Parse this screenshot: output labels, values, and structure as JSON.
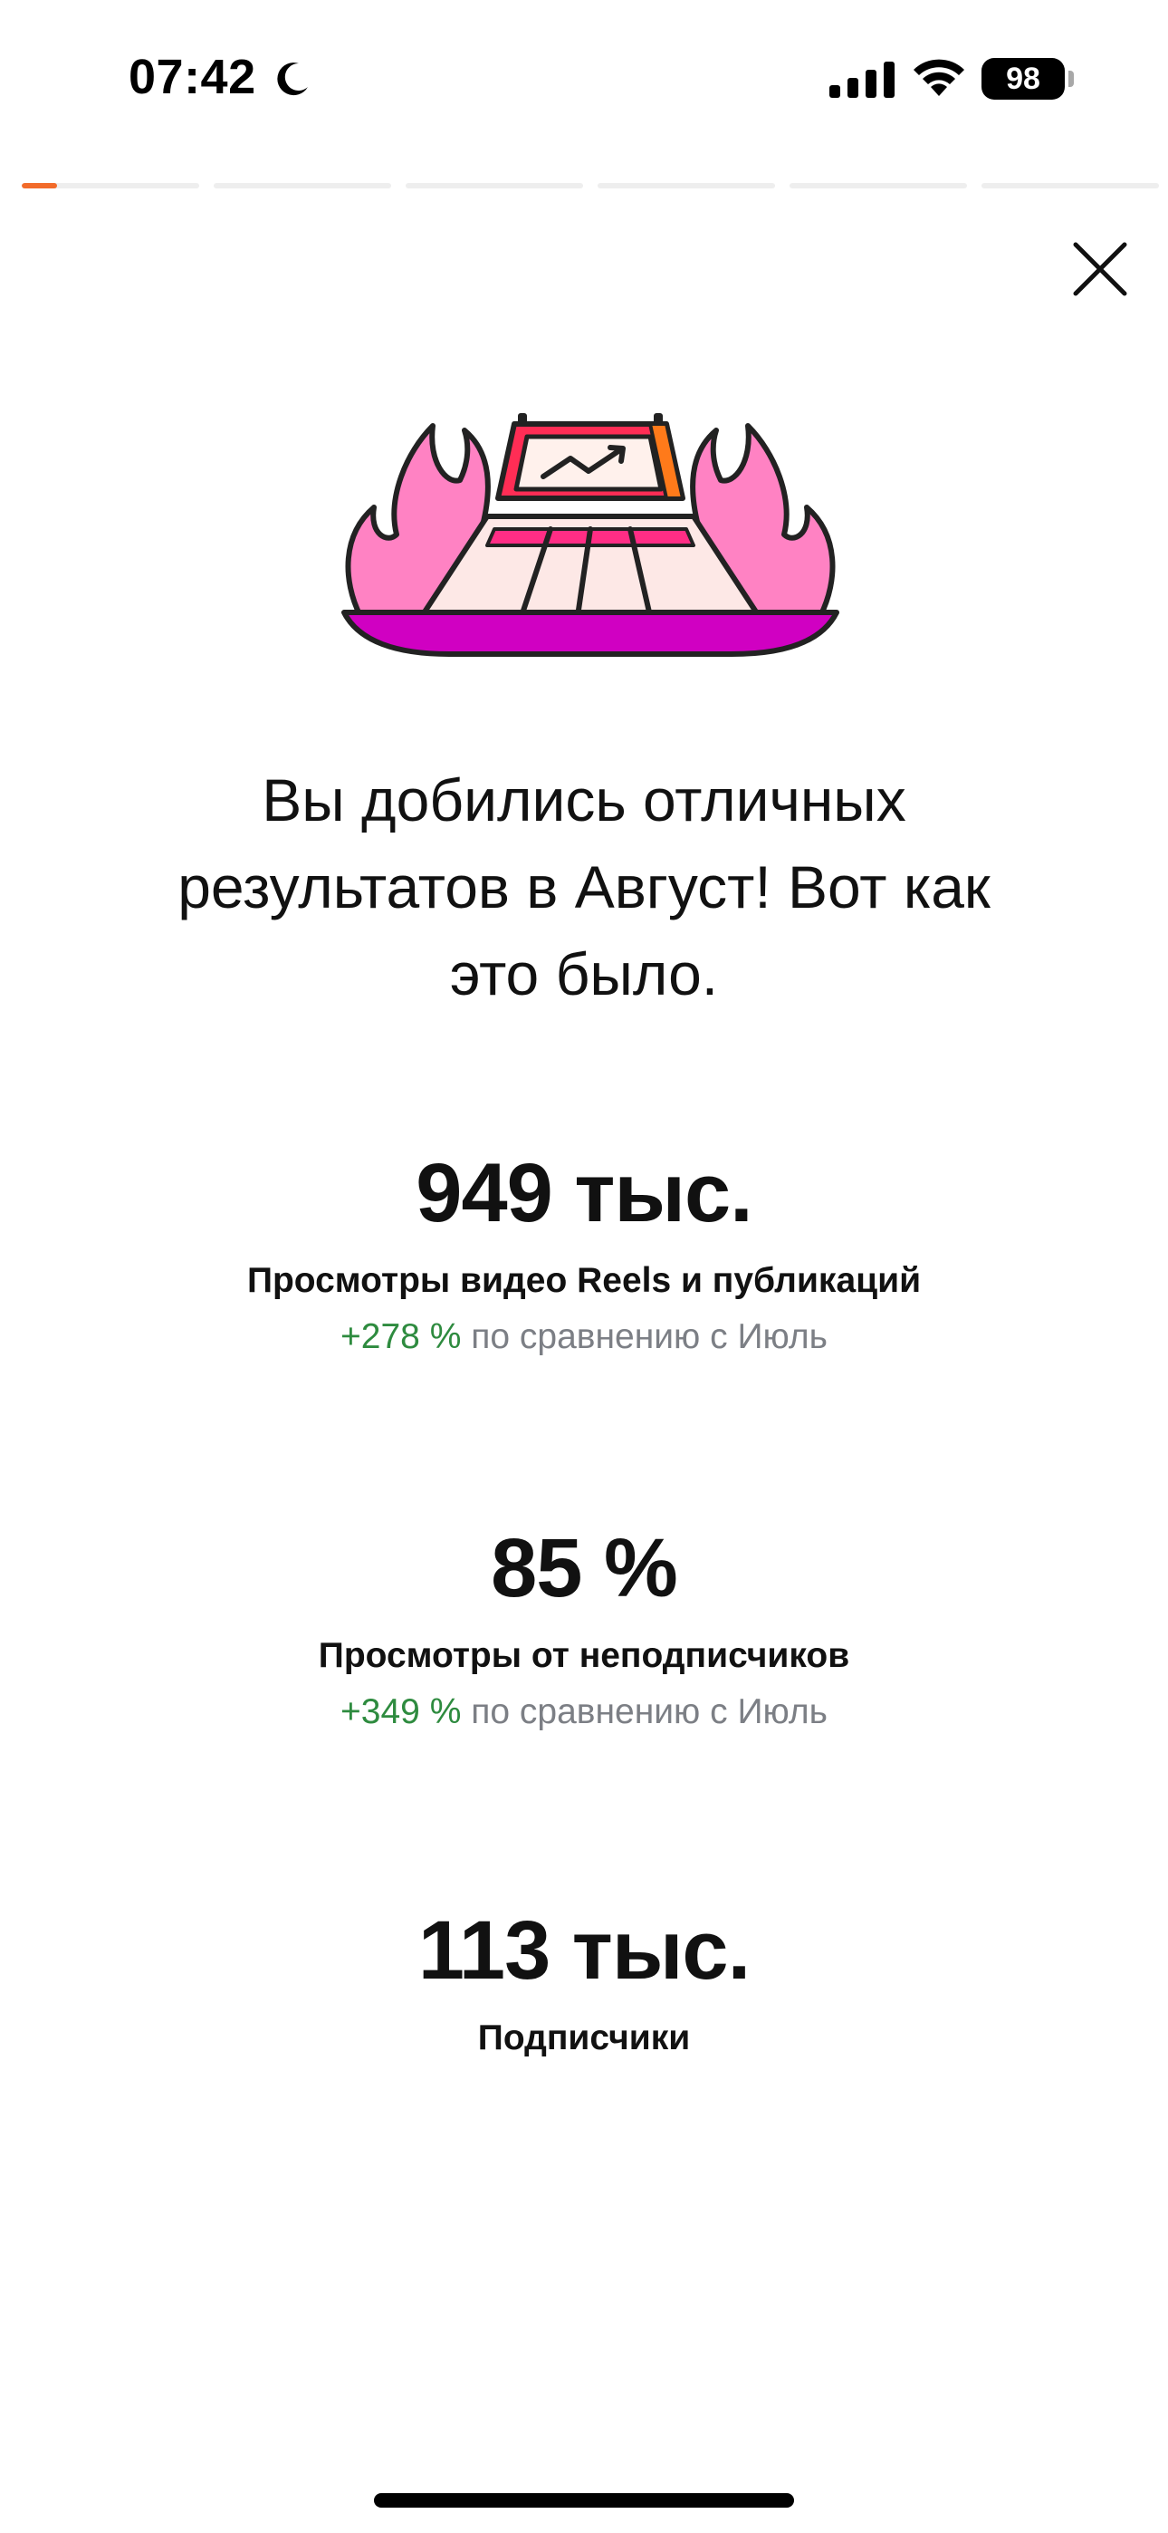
{
  "status_bar": {
    "time": "07:42",
    "battery": "98"
  },
  "story_progress": {
    "segments": 6,
    "active_index": 0,
    "active_fraction": 0.2,
    "accent": "#f26b2a"
  },
  "close": {
    "icon": "close-icon"
  },
  "illustration": {
    "icon": "flaming-stage-chart-illustration"
  },
  "headline": "Вы добились отличных результатов в Август! Вот как это было.",
  "metrics": [
    {
      "value": "949 тыс.",
      "label": "Просмотры видео Reels и публикаций",
      "delta": "+278 %",
      "comparison": "по сравнению с Июль"
    },
    {
      "value": "85 %",
      "label": "Просмотры от неподписчиков",
      "delta": "+349 %",
      "comparison": "по сравнению с Июль"
    },
    {
      "value": "113 тыс.",
      "label": "Подписчики"
    }
  ],
  "colors": {
    "positive": "#2e8b3f",
    "muted": "#7c7f85",
    "flame": "#ff82c3",
    "tray": "#d000c2"
  }
}
